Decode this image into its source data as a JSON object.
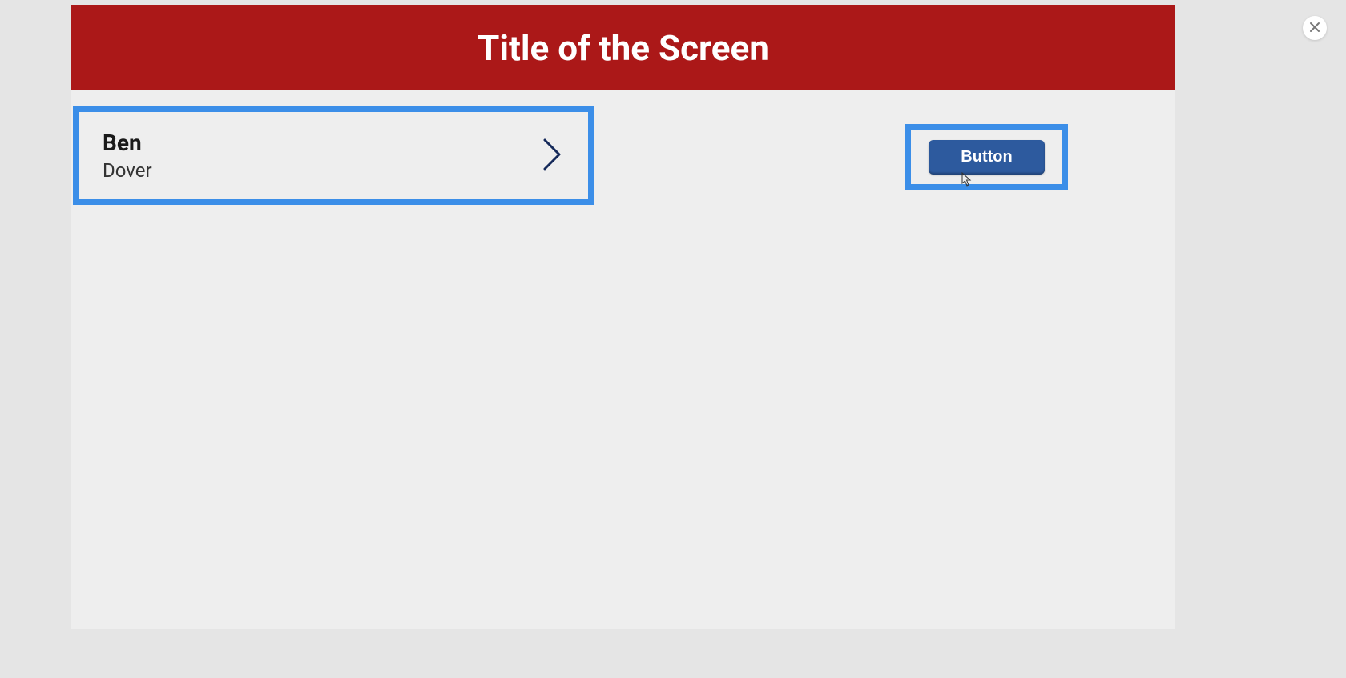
{
  "header": {
    "title": "Title of the Screen"
  },
  "card": {
    "title": "Ben",
    "subtitle": "Dover"
  },
  "button": {
    "label": "Button"
  }
}
